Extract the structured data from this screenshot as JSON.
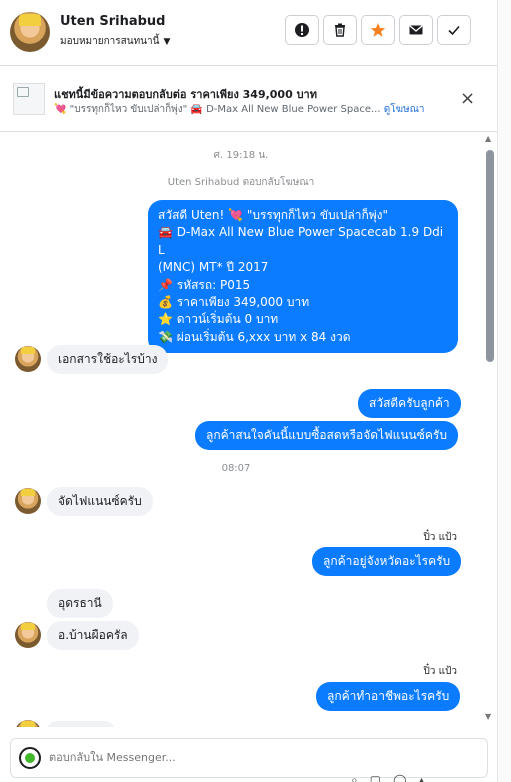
{
  "header": {
    "name": "Uten Srihabud",
    "assign": "มอบหมายการสนทนานี้",
    "actions": [
      {
        "name": "mark-spam-button",
        "icon": "!"
      },
      {
        "name": "delete-button",
        "icon": "trash"
      },
      {
        "name": "star-button",
        "icon": "★"
      },
      {
        "name": "mark-unread-button",
        "icon": "envelope"
      },
      {
        "name": "done-button",
        "icon": "✓"
      }
    ]
  },
  "ad": {
    "title": "แชทนี้มีข้อความตอบกลับต่อ ราคาเพียง 349,000 บาท",
    "subtitle": "💘 \"บรรทุกก็ไหว ขับเปล่าก็พุ่ง\" 🚘 D-Max All New Blue Power Space...",
    "link": "ดูโฆษณา",
    "close": "×"
  },
  "chat": {
    "timestamp1": "ศ. 19:18 น.",
    "reply_note": "Uten Srihabud ตอบกลับโฆษณา",
    "ad_message_lines": [
      "สวัสดี Uten! 💘 \"บรรทุกก็ไหว ขับเปล่าก็พุ่ง\"",
      "🚘 D-Max All New Blue Power Spacecab 1.9 Ddi L",
      "(MNC) MT* ปี 2017",
      "📌 รหัสรถ: P015",
      "💰 ราคาเพียง 349,000 บาท",
      "⭐ ดาวน์เริ่มต้น 0 บาท",
      "💸 ผ่อนเริ่มต้น 6,xxx บาท x 84 งวด"
    ],
    "msg_in_1": "เอกสารใช้อะไรบ้าง",
    "msg_out_1": "สวัสดีครับลูกค้า",
    "msg_out_2": "ลูกค้าสนใจคันนี้แบบซื้อสดหรือจัดไฟแนนซ์ครับ",
    "timestamp2": "08:07",
    "msg_in_2": "จัดไฟแนนซ์ครับ",
    "seen1": "ปิ๋ว แป้ว",
    "msg_out_3": "ลูกค้าอยู่จังหวัดอะไรครับ",
    "msg_in_3": "อุดรธานี",
    "msg_in_4": "อ.บ้านผือครัล",
    "seen2": "ปิ๋ว แป้ว",
    "msg_out_4": "ลูกค้าทำอาชีพอะไรครับ"
  },
  "composer": {
    "placeholder": "ตอบกลับใน Messenger..."
  },
  "colors": {
    "outgoing": "#0b7bff",
    "incoming": "#f0f2f5",
    "star": "#f5821f",
    "link": "#216fdb"
  }
}
